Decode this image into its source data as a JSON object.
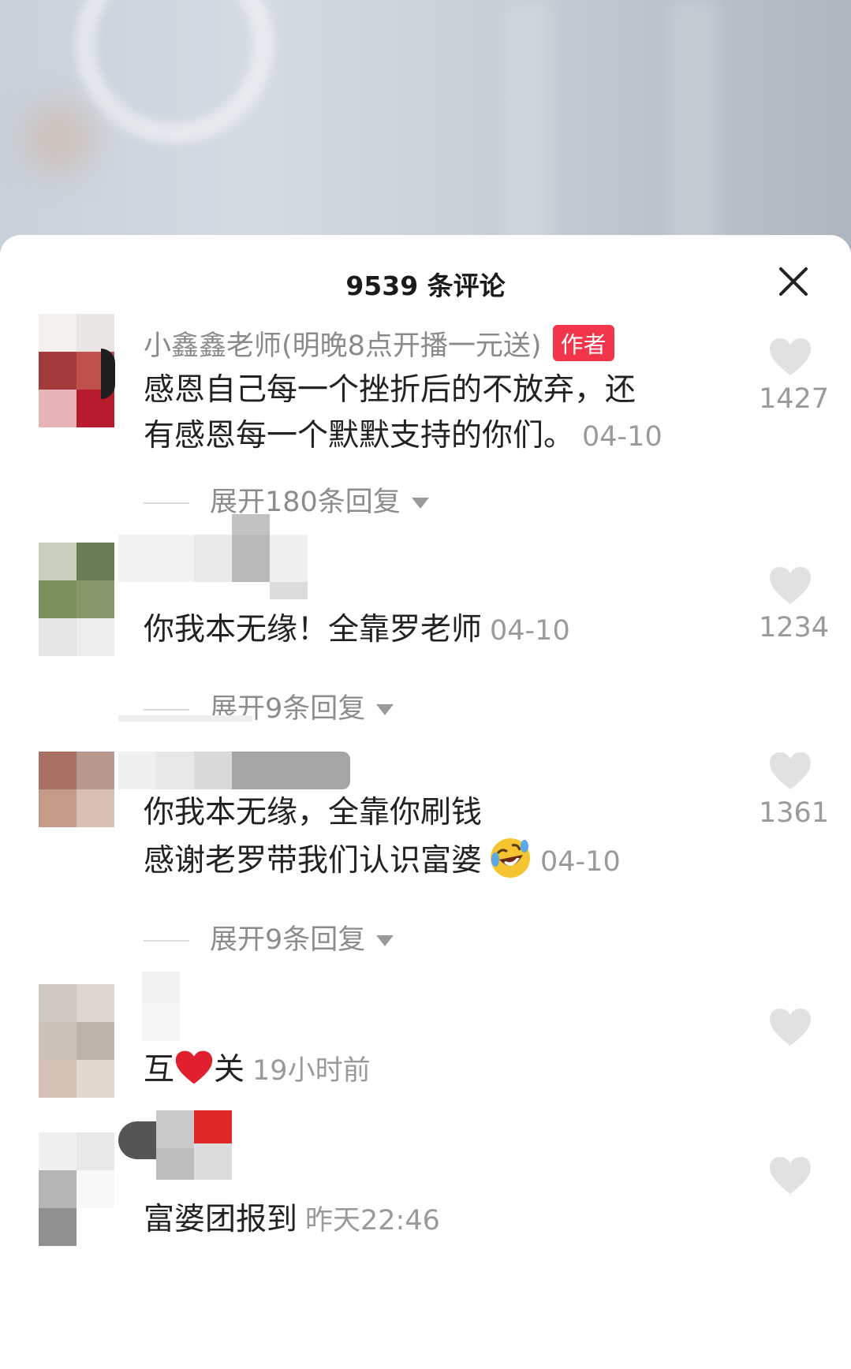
{
  "header": {
    "title": "9539 条评论"
  },
  "colors": {
    "author_tag": "#f2354a",
    "muted": "#9a9a9a",
    "heart": "#e1e1e1"
  },
  "comments": [
    {
      "name": "小鑫鑫老师(明晚8点开播一元送)",
      "author_tag": "作者",
      "lines": [
        "感恩自己每一个挫折后的不放弃，还",
        "有感恩每一个默默支持的你们。"
      ],
      "time": "04-10",
      "likes": "1427",
      "expand": "展开180条回复"
    },
    {
      "lines": [
        "你我本无缘！全靠罗老师"
      ],
      "time": "04-10",
      "likes": "1234",
      "expand": "展开9条回复"
    },
    {
      "lines": [
        "你我本无缘，全靠你刷钱",
        "感谢老罗带我们认识富婆"
      ],
      "emoji": "rolling-on-floor-laughing-emoji",
      "time": "04-10",
      "likes": "1361",
      "expand": "展开9条回复"
    },
    {
      "text_before": "互",
      "inline_icon": "red-heart-emoji",
      "text_after": "关",
      "time": "19小时前"
    },
    {
      "lines": [
        "富婆团报到"
      ],
      "time": "昨天22:46"
    }
  ]
}
